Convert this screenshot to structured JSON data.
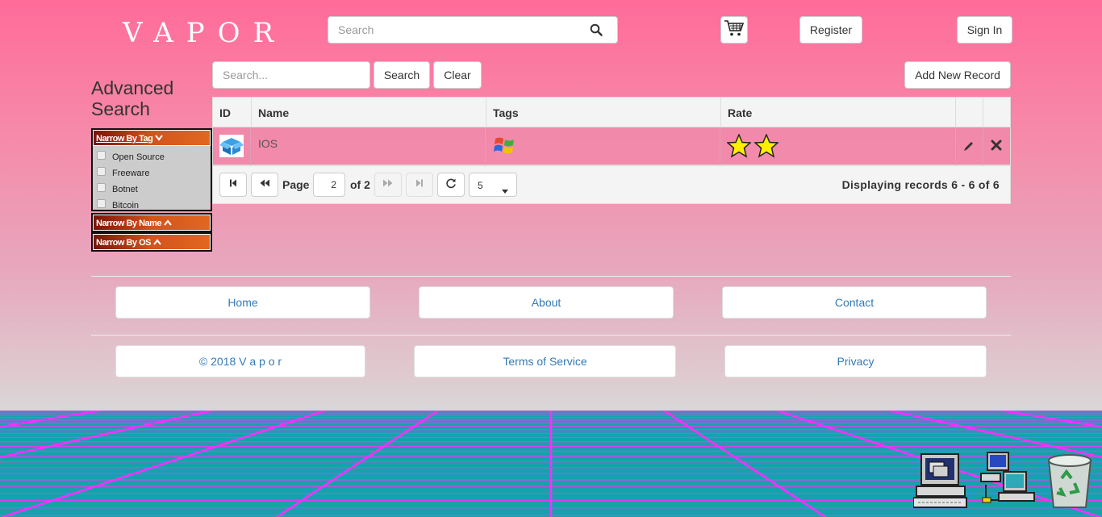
{
  "header": {
    "logo": "VAPOR",
    "search_placeholder": "Search",
    "register_label": "Register",
    "signin_label": "Sign In"
  },
  "sidebar": {
    "title": "Advanced Search",
    "tag_header": "Narrow By Tag",
    "tag_options": [
      "Open Source",
      "Freeware",
      "Botnet",
      "Bitcoin"
    ],
    "name_header": "Narrow By Name",
    "os_header": "Narrow By OS"
  },
  "toolbar": {
    "search_placeholder": "Search...",
    "search_label": "Search",
    "clear_label": "Clear",
    "add_label": "Add New Record"
  },
  "table": {
    "columns": [
      "ID",
      "Name",
      "Tags",
      "Rate"
    ],
    "rows": [
      {
        "id_icon": "box-icon",
        "name": "IOS",
        "tag_icon": "windows-logo-icon",
        "rating": 2
      }
    ]
  },
  "pager": {
    "page_label": "Page",
    "page_value": "2",
    "of_label": "of 2",
    "page_size": "5",
    "summary": "Displaying records 6 - 6 of 6"
  },
  "footer": {
    "home": "Home",
    "about": "About",
    "contact": "Contact",
    "copyright": "© 2018 V a p o r",
    "terms": "Terms of Service",
    "privacy": "Privacy"
  },
  "desktop_icons": [
    "computer-icon",
    "network-icon",
    "recycle-bin-icon"
  ],
  "colors": {
    "bg_top": "#ff6b9a",
    "bg_bottom": "#d8d8d8",
    "grid_line": "#ff2dff",
    "grid_bg": "#16a2ad",
    "link": "#337ab7"
  }
}
